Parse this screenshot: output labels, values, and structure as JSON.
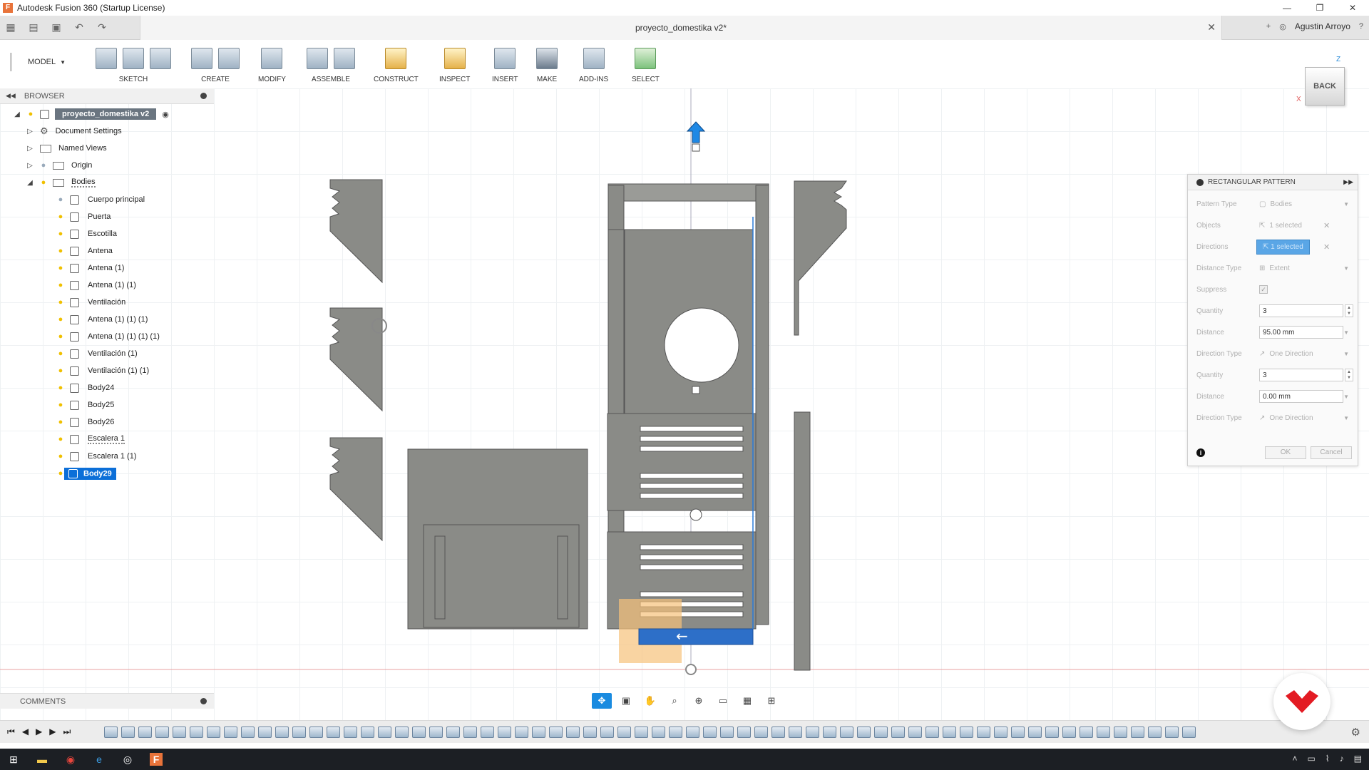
{
  "window": {
    "title": "Autodesk Fusion 360 (Startup License)",
    "app_icon_letter": "F",
    "controls": [
      "—",
      "❐",
      "✕"
    ]
  },
  "quick_access": {
    "document_title": "proyecto_domestika v2*",
    "user": "Agustin Arroyo"
  },
  "toolbar": {
    "mode": "MODEL",
    "groups": [
      "SKETCH",
      "CREATE",
      "MODIFY",
      "ASSEMBLE",
      "CONSTRUCT",
      "INSPECT",
      "INSERT",
      "MAKE",
      "ADD-INS",
      "SELECT"
    ]
  },
  "browser": {
    "title": "BROWSER",
    "root": "proyecto_domestika v2",
    "items": [
      {
        "label": "Document Settings",
        "kind": "settings"
      },
      {
        "label": "Named Views",
        "kind": "folder"
      },
      {
        "label": "Origin",
        "kind": "folder"
      },
      {
        "label": "Bodies",
        "kind": "folder"
      }
    ],
    "bodies": [
      "Cuerpo principal",
      "Puerta",
      "Escotilla",
      "Antena",
      "Antena (1)",
      "Antena (1) (1)",
      "Ventilación",
      "Antena (1) (1) (1)",
      "Antena (1) (1) (1) (1)",
      "Ventilación (1)",
      "Ventilación (1) (1)",
      "Body24",
      "Body25",
      "Body26",
      "Escalera 1",
      "Escalera 1 (1)",
      "Body29"
    ]
  },
  "comments": {
    "title": "COMMENTS"
  },
  "viewcube": {
    "face": "BACK",
    "z_axis": "Z",
    "x_axis": "X"
  },
  "pattern_panel": {
    "title": "RECTANGULAR PATTERN",
    "pattern_type_label": "Pattern Type",
    "pattern_type_value": "Bodies",
    "objects_label": "Objects",
    "objects_value": "1 selected",
    "directions_label": "Directions",
    "directions_value": "1 selected",
    "distance_type_label": "Distance Type",
    "distance_type_value": "Extent",
    "suppress_label": "Suppress",
    "quantity_label": "Quantity",
    "quantity_1": "3",
    "distance_label": "Distance",
    "distance_1": "95.00 mm",
    "direction_type_label": "Direction Type",
    "direction_type_1": "One Direction",
    "quantity_2": "3",
    "distance_2": "0.00 mm",
    "direction_type_2": "One Direction",
    "ok": "OK",
    "cancel": "Cancel"
  },
  "colors": {
    "selection_blue": "#0c6fd8",
    "body_gray": "#8a8b87",
    "highlight_orange": "#f7c27a",
    "brand_red": "#e31b23"
  }
}
